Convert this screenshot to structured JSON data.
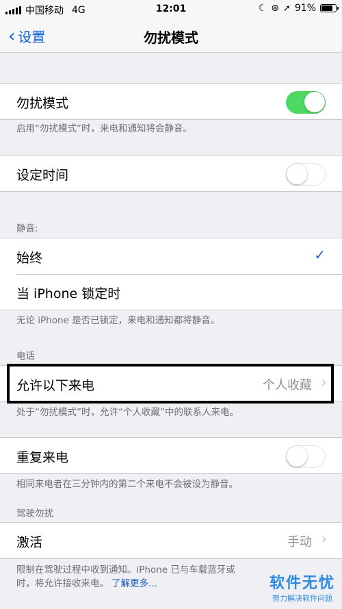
{
  "statusbar": {
    "carrier": "中国移动",
    "network": "4G",
    "time": "12:01",
    "battery": "91%",
    "battery_level": 0.91
  },
  "nav": {
    "back_label": "设置",
    "title": "勿扰模式"
  },
  "dnd": {
    "label": "勿扰模式",
    "on": true,
    "note": "启用“勿扰模式”时，来电和通知将会静音。"
  },
  "scheduled": {
    "label": "设定时间",
    "on": false
  },
  "silence": {
    "header": "静音:",
    "always": "始终",
    "locked": "当 iPhone 锁定时",
    "note": "无论 iPhone 是否已锁定，来电和通知都将静音。"
  },
  "phone": {
    "header": "电话",
    "allow_label": "允许以下来电",
    "allow_value": "个人收藏",
    "note": "处于“勿扰模式”时，允许“个人收藏”中的联系人来电。"
  },
  "repeated": {
    "label": "重复来电",
    "on": false,
    "note": "相同来电者在三分钟内的第二个来电不会被设为静音。"
  },
  "driving": {
    "header": "驾驶勿扰",
    "activate_label": "激活",
    "activate_value": "手动",
    "note_line1": "限制在驾驶过程中收到通知。iPhone 已与车载蓝牙或",
    "note_line2": "时，将允许接收来电。",
    "learn_more": "了解更多..."
  },
  "watermark": {
    "title": "软件无忧",
    "subtitle": "努力解决软件问题"
  },
  "colors": {
    "accent": "#0a62d6",
    "switch_on": "#4cd964"
  }
}
